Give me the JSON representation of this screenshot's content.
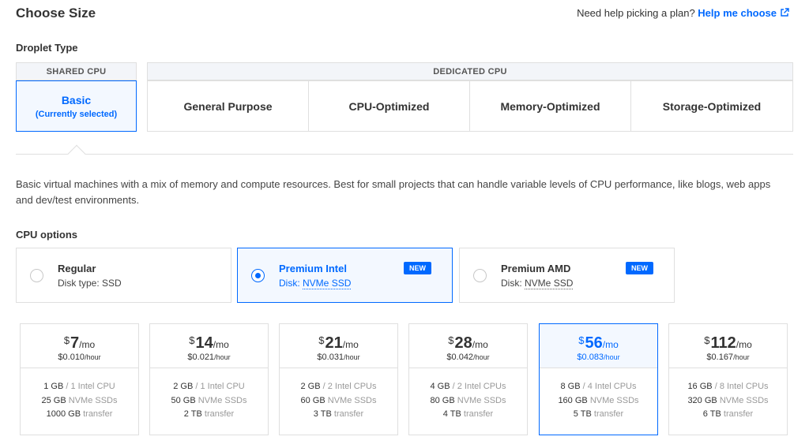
{
  "header": {
    "title": "Choose Size",
    "help_text": "Need help picking a plan?",
    "help_link": "Help me choose"
  },
  "droplet_type": {
    "label": "Droplet Type",
    "shared_header": "SHARED CPU",
    "dedicated_header": "DEDICATED CPU",
    "basic": {
      "label": "Basic",
      "sub": "(Currently selected)"
    },
    "dedicated_options": [
      "General Purpose",
      "CPU-Optimized",
      "Memory-Optimized",
      "Storage-Optimized"
    ]
  },
  "description": "Basic virtual machines with a mix of memory and compute resources. Best for small projects that can handle variable levels of CPU performance, like blogs, web apps and dev/test environments.",
  "cpu_options": {
    "label": "CPU options",
    "options": [
      {
        "name": "Regular",
        "disk_prefix": "Disk type:",
        "disk_value": "SSD",
        "badge": "",
        "selected": false
      },
      {
        "name": "Premium Intel",
        "disk_prefix": "Disk:",
        "disk_value": "NVMe SSD",
        "badge": "NEW",
        "selected": true
      },
      {
        "name": "Premium AMD",
        "disk_prefix": "Disk:",
        "disk_value": "NVMe SSD",
        "badge": "NEW",
        "selected": false
      }
    ]
  },
  "plans": [
    {
      "currency": "$",
      "amount": "7",
      "per": "/mo",
      "hourly": "$0.010",
      "hourly_unit": "/hour",
      "ram": "1 GB",
      "cpu": "1 Intel CPU",
      "disk": "25 GB",
      "disk_type": "NVMe SSDs",
      "transfer": "1000 GB",
      "transfer_label": "transfer",
      "selected": false
    },
    {
      "currency": "$",
      "amount": "14",
      "per": "/mo",
      "hourly": "$0.021",
      "hourly_unit": "/hour",
      "ram": "2 GB",
      "cpu": "1 Intel CPU",
      "disk": "50 GB",
      "disk_type": "NVMe SSDs",
      "transfer": "2 TB",
      "transfer_label": "transfer",
      "selected": false
    },
    {
      "currency": "$",
      "amount": "21",
      "per": "/mo",
      "hourly": "$0.031",
      "hourly_unit": "/hour",
      "ram": "2 GB",
      "cpu": "2 Intel CPUs",
      "disk": "60 GB",
      "disk_type": "NVMe SSDs",
      "transfer": "3 TB",
      "transfer_label": "transfer",
      "selected": false
    },
    {
      "currency": "$",
      "amount": "28",
      "per": "/mo",
      "hourly": "$0.042",
      "hourly_unit": "/hour",
      "ram": "4 GB",
      "cpu": "2 Intel CPUs",
      "disk": "80 GB",
      "disk_type": "NVMe SSDs",
      "transfer": "4 TB",
      "transfer_label": "transfer",
      "selected": false
    },
    {
      "currency": "$",
      "amount": "56",
      "per": "/mo",
      "hourly": "$0.083",
      "hourly_unit": "/hour",
      "ram": "8 GB",
      "cpu": "4 Intel CPUs",
      "disk": "160 GB",
      "disk_type": "NVMe SSDs",
      "transfer": "5 TB",
      "transfer_label": "transfer",
      "selected": true
    },
    {
      "currency": "$",
      "amount": "112",
      "per": "/mo",
      "hourly": "$0.167",
      "hourly_unit": "/hour",
      "ram": "16 GB",
      "cpu": "8 Intel CPUs",
      "disk": "320 GB",
      "disk_type": "NVMe SSDs",
      "transfer": "6 TB",
      "transfer_label": "transfer",
      "selected": false
    }
  ],
  "colors": {
    "accent": "#0069ff",
    "selected_bg": "#f3f8ff",
    "border": "#dfdfdf"
  },
  "icons": {
    "help_link_icon": "external-link-icon"
  }
}
